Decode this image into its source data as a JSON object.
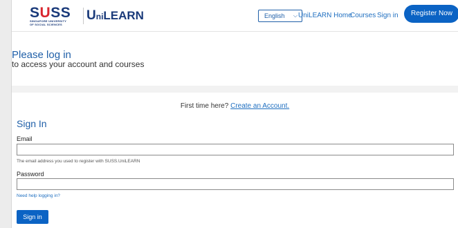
{
  "header": {
    "logo": {
      "suss_word": "SUSS",
      "suss_sub_line1": "SINGAPORE UNIVERSITY",
      "suss_sub_line2": "OF SOCIAL SCIENCES",
      "unilearn": "UniLEARN"
    },
    "language": {
      "selected": "English"
    },
    "nav": {
      "home": "UniLEARN Home",
      "courses": "Courses",
      "signin": "Sign in"
    },
    "register_label": "Register Now"
  },
  "hero": {
    "title": "Please log in",
    "subtitle": "to access your account and courses"
  },
  "first_time": {
    "prefix": "First time here?",
    "link": "Create an Account."
  },
  "form": {
    "title": "Sign In",
    "email_label": "Email",
    "email_value": "",
    "email_help": "The email address you used to register with SUSS.UniLEARN",
    "password_label": "Password",
    "password_value": "",
    "need_help": "Need help logging in?",
    "submit_label": "Sign in"
  },
  "colors": {
    "primary": "#0b63c4",
    "link": "#1f6fc0",
    "brand_blue": "#1a3a7a",
    "brand_red": "#d9262e"
  }
}
